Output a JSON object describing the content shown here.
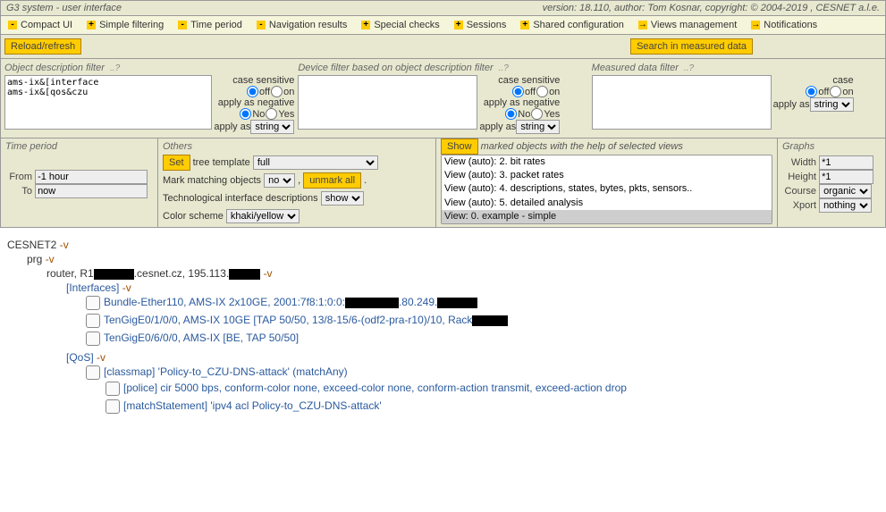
{
  "header": {
    "title": "G3 system - user interface",
    "version": "version: 18.110, author: Tom Kosnar, copyright: © 2004-2019 , CESNET a.l.e."
  },
  "menu": [
    {
      "sym": "-",
      "label": "Compact UI"
    },
    {
      "sym": "+",
      "label": "Simple filtering"
    },
    {
      "sym": "-",
      "label": "Time period"
    },
    {
      "sym": "-",
      "label": "Navigation results"
    },
    {
      "sym": "+",
      "label": "Special checks"
    },
    {
      "sym": "+",
      "label": "Sessions"
    },
    {
      "sym": "+",
      "label": "Shared configuration"
    },
    {
      "sym": "→",
      "label": "Views management"
    },
    {
      "sym": "→",
      "label": "Notifications"
    }
  ],
  "buttons": {
    "reload": "Reload/refresh",
    "search": "Search in measured data",
    "show": "Show",
    "set": "Set",
    "unmark": "unmark all"
  },
  "filters": {
    "obj": {
      "title": "Object description filter",
      "value": "ams-ix&[interface\nams-ix&[qos&czu"
    },
    "dev": {
      "title": "Device filter based on object description filter",
      "value": ""
    },
    "data": {
      "title": "Measured data filter",
      "value": ""
    }
  },
  "opts": {
    "case": "case sensitive",
    "case_short": "case",
    "off": "off",
    "on": "on",
    "neg": "apply as negative",
    "no": "No",
    "yes": "Yes",
    "apply": "apply as",
    "string": "string"
  },
  "time": {
    "title": "Time period",
    "from_lbl": "From",
    "from": "-1 hour",
    "to_lbl": "To",
    "to": "now"
  },
  "others": {
    "title": "Others",
    "tree_lbl": "tree template",
    "tree": "full",
    "mark_lbl": "Mark matching objects",
    "mark": "no",
    "tech_lbl": "Technological interface descriptions",
    "tech": "show",
    "color_lbl": "Color scheme",
    "color": "khaki/yellow"
  },
  "views": {
    "caption": "marked objects with the help of selected views",
    "options": [
      "View (auto): 2. bit rates",
      "View (auto): 3. packet rates",
      "View (auto): 4. descriptions, states, bytes, pkts, sensors..",
      "View (auto): 5. detailed analysis",
      "View: 0. example - simple"
    ]
  },
  "graphs": {
    "title": "Graphs",
    "width_lbl": "Width",
    "width": "*1",
    "height_lbl": "Height",
    "height": "*1",
    "course_lbl": "Course",
    "course": "organic",
    "xport_lbl": "Xport",
    "xport": "nothing"
  },
  "tree": {
    "l0": "CESNET2",
    "l1": "prg",
    "l2a": "router, R1",
    "l2b": ".cesnet.cz, 195.113.",
    "l3": "[Interfaces]",
    "l4a": "Bundle-Ether110, AMS-IX 2x10GE, 2001:7f8:1:0:0:",
    "l4b": ".80.249.",
    "l5a": "TenGigE0/1/0/0, AMS-IX 10GE [TAP 50/50, 13/8-15/6-(odf2-pra-r10)/10, Rack",
    "l6": "TenGigE0/6/0/0, AMS-IX [BE, TAP 50/50]",
    "l7": "[QoS]",
    "l8": "[classmap] 'Policy-to_CZU-DNS-attack' (matchAny)",
    "l9": "[police] cir 5000 bps, conform-color none, exceed-color none, conform-action transmit, exceed-action drop",
    "l10": "[matchStatement] 'ipv4 acl Policy-to_CZU-DNS-attack'",
    "v": "-v"
  }
}
